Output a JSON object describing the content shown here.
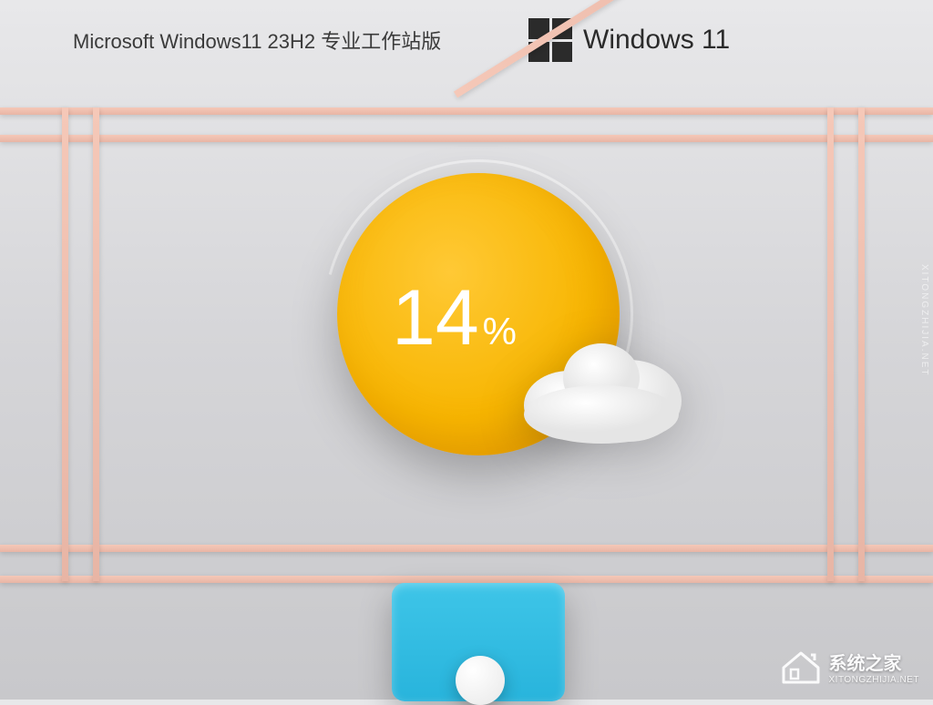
{
  "header": {
    "title": "Microsoft Windows11 23H2 专业工作站版"
  },
  "logo": {
    "text": "Windows 11"
  },
  "progress": {
    "value": "14",
    "symbol": "%"
  },
  "watermark": {
    "main": "系统之家",
    "sub": "XITONGZHIJIA.NET"
  },
  "side_watermark": "XITONGZHIJIA.NET",
  "colors": {
    "accent_yellow": "#f7b500",
    "accent_cyan": "#3ec5e8",
    "frame": "#f0c0b0"
  }
}
